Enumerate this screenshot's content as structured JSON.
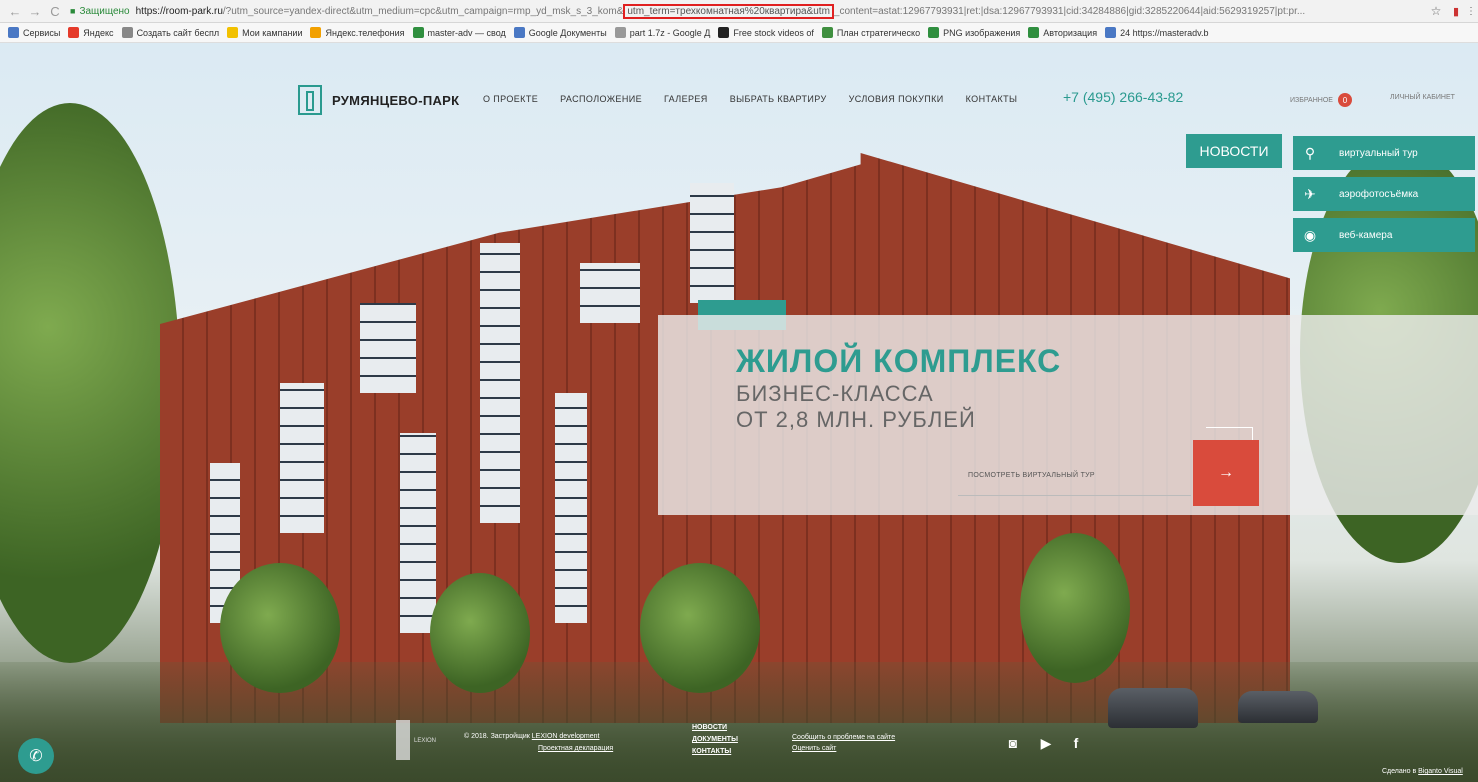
{
  "browser": {
    "secure_label": "Защищено",
    "url_host": "https://room-park.ru",
    "url_before": "/?utm_source=yandex-direct&utm_medium=cpc&utm_campaign=rmp_yd_msk_s_3_kom&",
    "url_highlight": "utm_term=трехкомнатная%20квартира&utm",
    "url_after": "_content=astat:12967793931|ret:|dsa:12967793931|cid:34284886|gid:3285220644|aid:5629319257|pt:pr..."
  },
  "bookmarks": [
    {
      "label": "Сервисы",
      "color": "#4a78c4"
    },
    {
      "label": "Яндекс",
      "color": "#e53a2a"
    },
    {
      "label": "Создать сайт беспл",
      "color": "#888888"
    },
    {
      "label": "Мои кампании",
      "color": "#f2c100"
    },
    {
      "label": "Яндекс.телефония",
      "color": "#f2a000"
    },
    {
      "label": "master-adv — свод",
      "color": "#2f8f3f"
    },
    {
      "label": "Google Документы",
      "color": "#4a78c4"
    },
    {
      "label": "part 1.7z - Google Д",
      "color": "#999999"
    },
    {
      "label": "Free stock videos of",
      "color": "#222222"
    },
    {
      "label": "План стратегическо",
      "color": "#3f8f3f"
    },
    {
      "label": "PNG изображения",
      "color": "#2f8f3f"
    },
    {
      "label": "Авторизация",
      "color": "#2f8f3f"
    },
    {
      "label": "24  https://masteradv.b",
      "color": "#4a78c4"
    }
  ],
  "header": {
    "logo": "РУМЯНЦЕВО-ПАРК",
    "menu": [
      "О ПРОЕКТЕ",
      "РАСПОЛОЖЕНИЕ",
      "ГАЛЕРЕЯ",
      "ВЫБРАТЬ КВАРТИРУ",
      "УСЛОВИЯ ПОКУПКИ",
      "КОНТАКТЫ"
    ],
    "phone": "+7 (495) 266-43-82",
    "favorites": "ИЗБРАННОЕ",
    "favorites_count": "0",
    "cabinet": "ЛИЧНЫЙ КАБИНЕТ"
  },
  "side": {
    "news": "НОВОСТИ",
    "buttons": [
      {
        "label": "виртуальный тур",
        "icon": "person-pin-icon"
      },
      {
        "label": "аэрофотосъёмка",
        "icon": "drone-icon"
      },
      {
        "label": "веб-камера",
        "icon": "webcam-icon"
      }
    ]
  },
  "promo": {
    "line1": "ЖИЛОЙ КОМПЛЕКС",
    "line2": "БИЗНЕС-КЛАССА",
    "line3": "ОТ 2,8 МЛН. РУБЛЕЙ",
    "cta": "ПОСМОТРЕТЬ ВИРТУАЛЬНЫЙ ТУР",
    "arrow": "→"
  },
  "footer": {
    "copy_prefix": "© 2018. Застройщик",
    "developer": "LEXION development",
    "declaration": "Проектная декларация",
    "logo_text": "LEXION",
    "nav": [
      "НОВОСТИ",
      "ДОКУМЕНТЫ",
      "КОНТАКТЫ"
    ],
    "report": "Сообщить о проблеме на сайте",
    "rate": "Оценить сайт",
    "made_prefix": "Сделано в",
    "made_link": "Biganto Visual"
  },
  "colors": {
    "accent": "#2e9c90",
    "red": "#d94b3c"
  }
}
